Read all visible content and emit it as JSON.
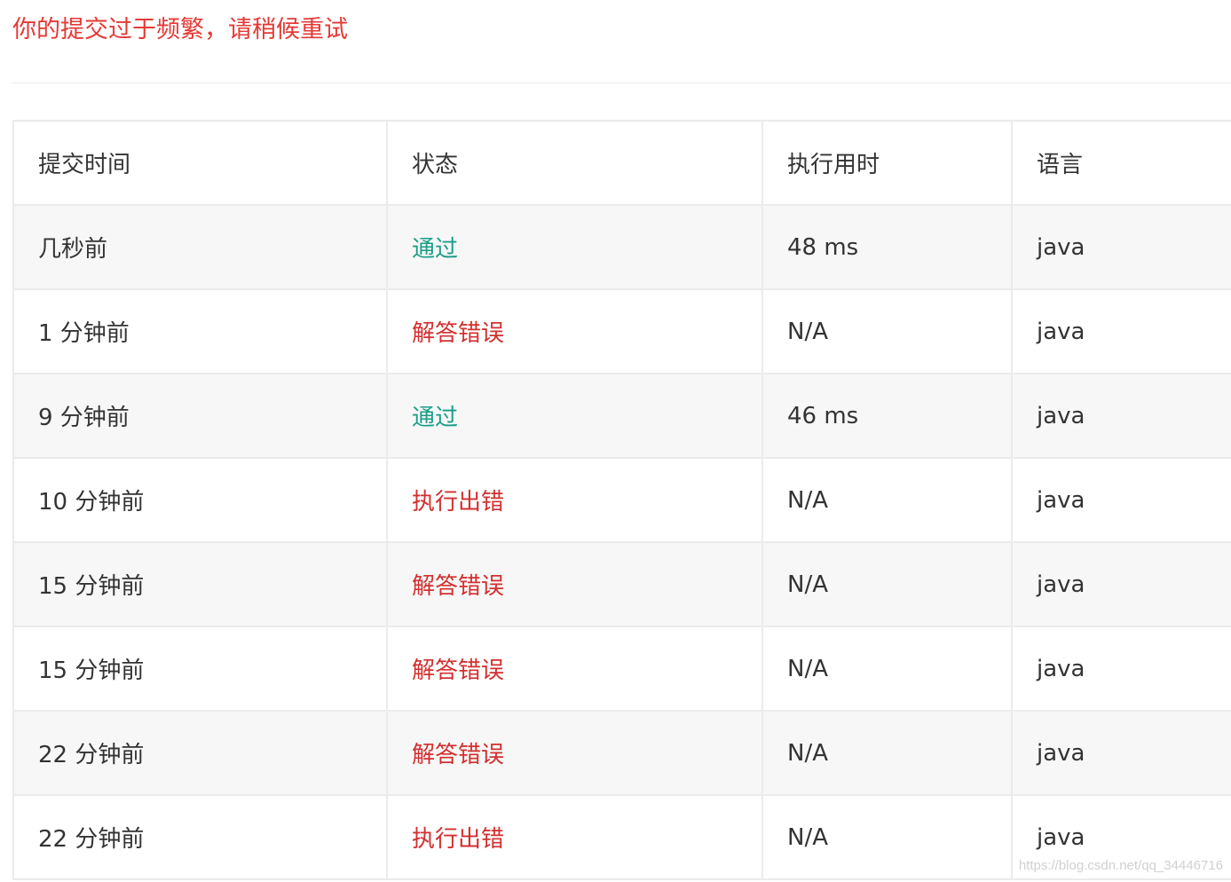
{
  "notice": {
    "message": "你的提交过于频繁，请稍候重试",
    "color": "#e53935"
  },
  "table": {
    "headers": [
      "提交时间",
      "状态",
      "执行用时",
      "语言"
    ],
    "rows": [
      {
        "time": "几秒前",
        "status": "通过",
        "status_type": "accepted",
        "runtime": "48 ms",
        "language": "java"
      },
      {
        "time": "1 分钟前",
        "status": "解答错误",
        "status_type": "wrong",
        "runtime": "N/A",
        "language": "java"
      },
      {
        "time": "9 分钟前",
        "status": "通过",
        "status_type": "accepted",
        "runtime": "46 ms",
        "language": "java"
      },
      {
        "time": "10 分钟前",
        "status": "执行出错",
        "status_type": "runtime",
        "runtime": "N/A",
        "language": "java"
      },
      {
        "time": "15 分钟前",
        "status": "解答错误",
        "status_type": "wrong",
        "runtime": "N/A",
        "language": "java"
      },
      {
        "time": "15 分钟前",
        "status": "解答错误",
        "status_type": "wrong",
        "runtime": "N/A",
        "language": "java"
      },
      {
        "time": "22 分钟前",
        "status": "解答错误",
        "status_type": "wrong",
        "runtime": "N/A",
        "language": "java"
      },
      {
        "time": "22 分钟前",
        "status": "执行出错",
        "status_type": "runtime",
        "runtime": "N/A",
        "language": "java"
      }
    ]
  },
  "colors": {
    "accepted": "#1a9e87",
    "error": "#d32f2f",
    "row_alt": "#f7f7f7",
    "border": "#ebebeb"
  },
  "watermark": "https://blog.csdn.net/qq_34446716"
}
